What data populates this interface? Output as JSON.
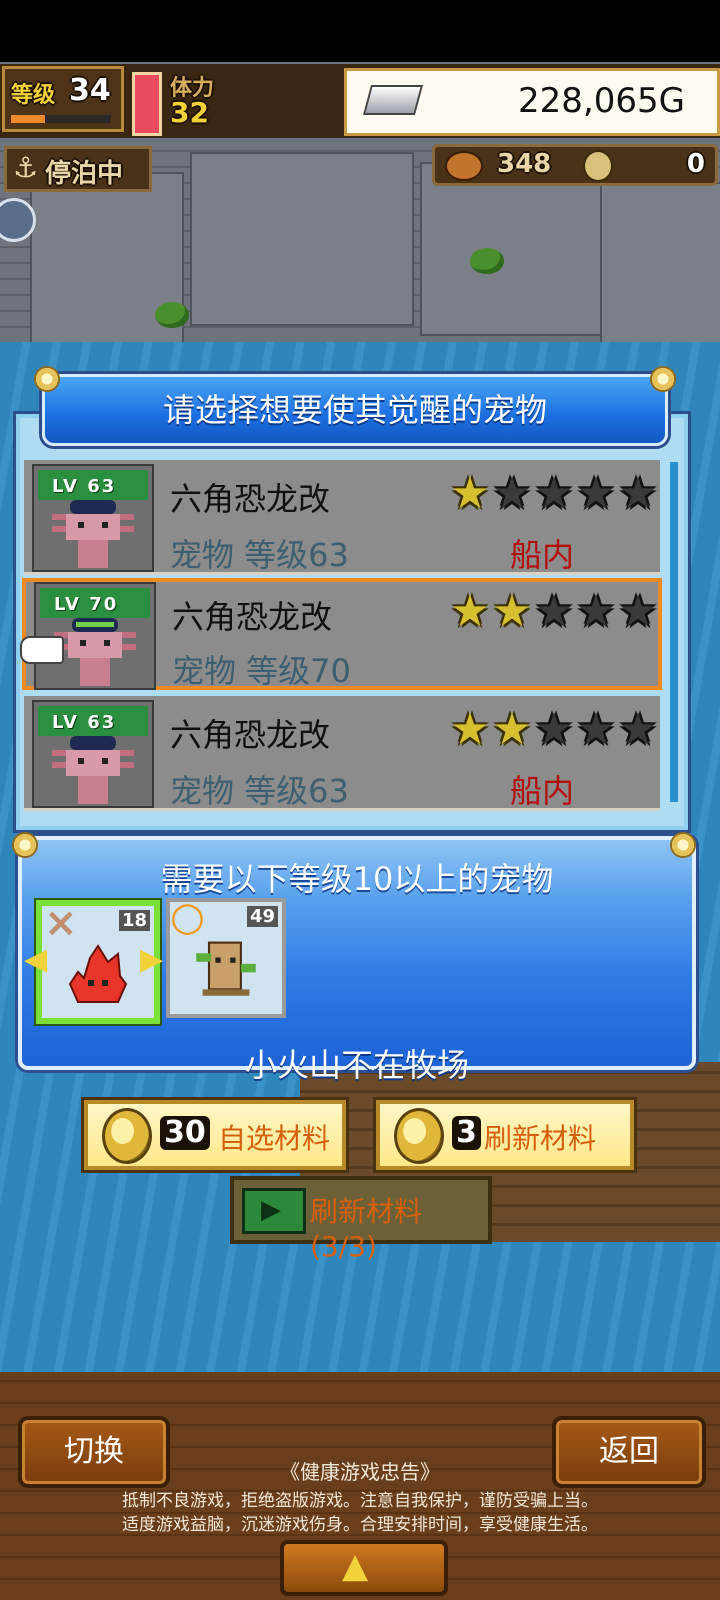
{
  "hud": {
    "level_label": "等级",
    "level_value": "34",
    "stamina_label": "体力",
    "stamina_value": "32",
    "gold": "228,065G",
    "status": "停泊中",
    "food": "348",
    "coins": "0"
  },
  "dialog": {
    "title": "请选择想要使其觉醒的宠物",
    "pets": [
      {
        "lv_tag": "LV 63",
        "name": "六角恐龙改",
        "level_text": "宠物 等级63",
        "location": "船内",
        "stars_filled": 1,
        "stars_total": 5,
        "selected": false
      },
      {
        "lv_tag": "LV 70",
        "name": "六角恐龙改",
        "level_text": "宠物 等级70",
        "location": "",
        "stars_filled": 2,
        "stars_total": 5,
        "selected": true
      },
      {
        "lv_tag": "LV 63",
        "name": "六角恐龙改",
        "level_text": "宠物 等级63",
        "location": "船内",
        "stars_filled": 2,
        "stars_total": 5,
        "selected": false
      }
    ]
  },
  "requirement": {
    "title": "需要以下等级10以上的宠物",
    "materials": [
      {
        "icon": "fire-spirit-icon",
        "level": "18",
        "mark": "×",
        "selected": true
      },
      {
        "icon": "tree-stump-icon",
        "level": "49",
        "mark": "○",
        "selected": false
      }
    ],
    "message": "小火山不在牧场"
  },
  "actions": {
    "choose_cost": "30",
    "choose_label": "自选材料",
    "refresh_cost": "3",
    "refresh_label": "刷新材料",
    "video_refresh_label": "刷新材料(3/3)"
  },
  "footer": {
    "switch_label": "切换",
    "back_label": "返回",
    "notice_title": "《健康游戏忠告》",
    "notice_line1": "抵制不良游戏，拒绝盗版游戏。注意自我保护，谨防受骗上当。",
    "notice_line2": "适度游戏益脑，沉迷游戏伤身。合理安排时间，享受健康生活。"
  },
  "colors": {
    "accent_blue": "#1c6ee0",
    "selected_border": "#f08a1e",
    "location_red": "#b40d0d",
    "star_gold": "#d6c030"
  }
}
